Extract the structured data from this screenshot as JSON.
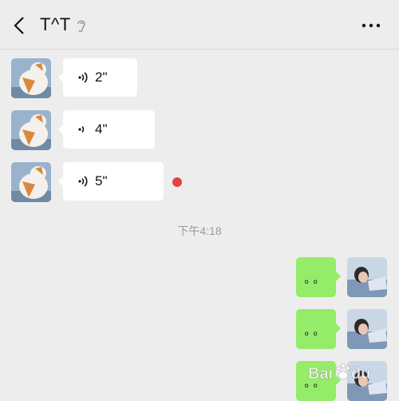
{
  "header": {
    "title": "T^T",
    "back_icon": "chevron-left-icon",
    "ear_icon": "ear-icon",
    "more_icon": "more-dots-icon"
  },
  "incoming": [
    {
      "duration": "2\"",
      "unread": false
    },
    {
      "duration": "4\"",
      "unread": false
    },
    {
      "duration": "5\"",
      "unread": true
    }
  ],
  "timestamp": "下午4:18",
  "outgoing": [
    {
      "text": "。。"
    },
    {
      "text": "。。"
    },
    {
      "text": "。。"
    }
  ],
  "watermark": "Baidu 经验",
  "colors": {
    "background": "#ededed",
    "sent_bubble": "#95ec69",
    "received_bubble": "#ffffff",
    "unread_dot": "#e64340"
  }
}
